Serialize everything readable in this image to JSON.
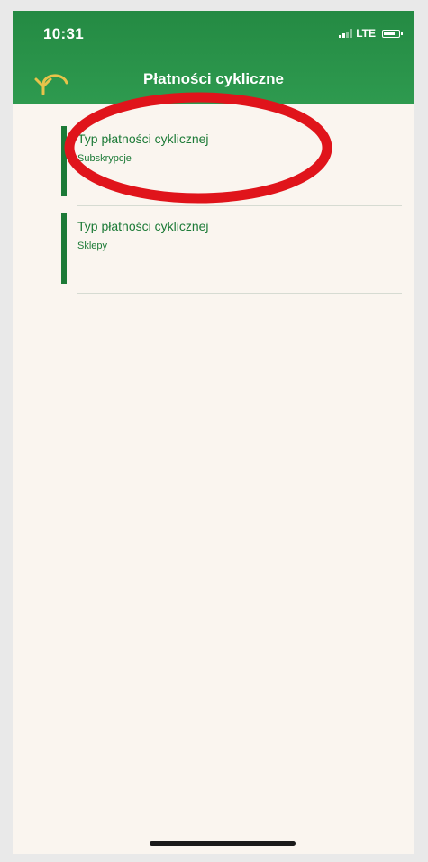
{
  "status_bar": {
    "time": "10:31",
    "network": "LTE"
  },
  "header": {
    "title": "Płatności cykliczne",
    "back_icon": "back-arrow-icon",
    "color": "#2e9a4f"
  },
  "list": {
    "items": [
      {
        "label": "Typ płatności cyklicznej",
        "value": "Subskrypcje"
      },
      {
        "label": "Typ płatności cyklicznej",
        "value": "Sklepy"
      }
    ]
  },
  "annotation": {
    "color": "#e0141b"
  }
}
